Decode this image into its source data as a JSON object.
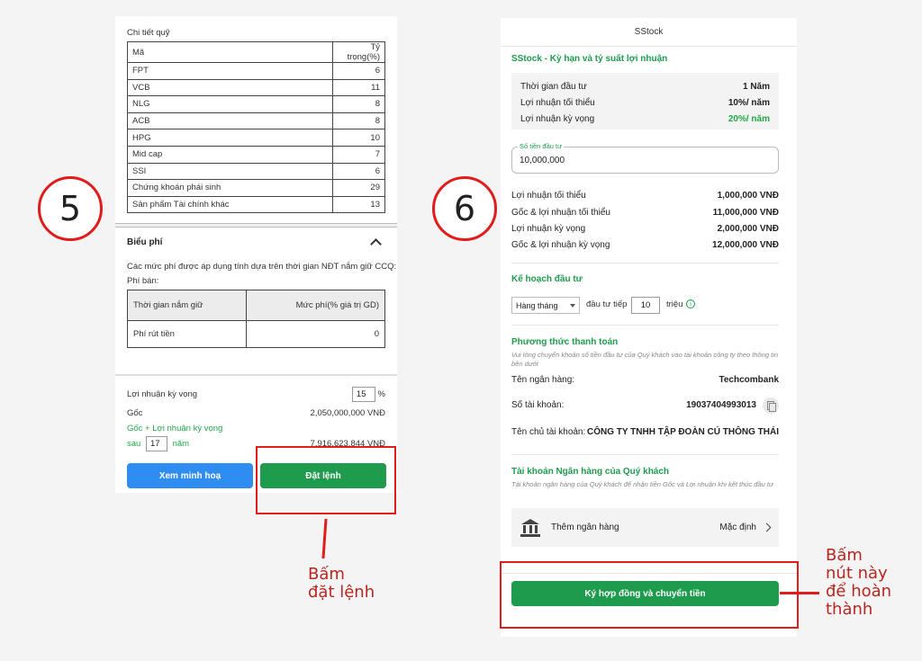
{
  "steps": {
    "left": "5",
    "right": "6"
  },
  "left_panel": {
    "fund_title": "Chi tiết quỹ",
    "fund_table": {
      "headers": [
        "Mã",
        "Tỷ trọng(%)"
      ],
      "rows": [
        [
          "FPT",
          "6"
        ],
        [
          "VCB",
          "11"
        ],
        [
          "NLG",
          "8"
        ],
        [
          "ACB",
          "8"
        ],
        [
          "HPG",
          "10"
        ],
        [
          "Mid cap",
          "7"
        ],
        [
          "SSI",
          "6"
        ],
        [
          "Chứng khoán phái sinh",
          "29"
        ],
        [
          "Sản phẩm Tài chính khác",
          "13"
        ]
      ]
    },
    "fee": {
      "title": "Biểu phí",
      "desc1": "Các mức phí được áp dụng tính dựa trên thời gian NĐT nắm giữ CCQ:",
      "desc2": "Phí bán:",
      "headers": [
        "Thời gian nắm giữ",
        "Mức phí(% giá trị GD)"
      ],
      "row": [
        "Phí rút tiền",
        "0"
      ]
    },
    "expected": {
      "label": "Lợi nhuận kỳ vọng",
      "value": "15",
      "unit": "%",
      "principal_label": "Gốc",
      "principal_value": "2,050,000,000 VNĐ",
      "total_label": "Gốc + Lợi nhuận kỳ vọng",
      "after_label": "sau",
      "years_value": "17",
      "years_unit": "năm",
      "total_value": "7,916,623,844 VNĐ"
    },
    "buttons": {
      "illustrate": "Xem minh hoạ",
      "order": "Đặt lệnh"
    },
    "annotation": [
      "Bấm",
      "đặt lệnh"
    ]
  },
  "right_panel": {
    "header": "SStock",
    "term_title": "SStock - Kỳ hạn và tỷ suất lợi nhuận",
    "summary": [
      {
        "label": "Thời gian đầu tư",
        "value": "1 Năm"
      },
      {
        "label": "Lợi nhuận tối thiểu",
        "value": "10%/ năm"
      },
      {
        "label": "Lợi nhuận kỳ vọng",
        "value": "20%/ năm"
      }
    ],
    "amount_legend": "Số tiền đầu tư",
    "amount_value": "10,000,000",
    "results": [
      {
        "label": "Lợi nhuận tối thiểu",
        "value": "1,000,000 VNĐ"
      },
      {
        "label": "Gốc & lợi nhuận tối thiểu",
        "value": "11,000,000 VNĐ"
      },
      {
        "label": "Lợi nhuận kỳ vọng",
        "value": "2,000,000 VNĐ"
      },
      {
        "label": "Gốc & lợi nhuận kỳ vọng",
        "value": "12,000,000 VNĐ"
      }
    ],
    "plan": {
      "title": "Kế hoạch đầu tư",
      "frequency": "Hàng tháng",
      "continue_label": "đầu tư tiếp",
      "continue_value": "10",
      "unit": "triệu",
      "info_glyph": "i"
    },
    "payment": {
      "title": "Phương thức thanh toán",
      "note": "Vui lòng chuyển khoản số tiền đầu tư của Quý khách vào tài khoản công ty theo thông tin bên dưới",
      "bank_label": "Tên ngân hàng:",
      "bank_value": "Techcombank",
      "account_label": "Số tài khoản:",
      "account_value": "19037404993013",
      "owner_label": "Tên chủ tài khoản:",
      "owner_value": "CÔNG TY TNHH TẬP ĐOÀN CÚ THÔNG THÁI"
    },
    "client_bank": {
      "title": "Tài khoản Ngân hàng của Quý khách",
      "note": "Tài khoản ngân hàng của Quý khách để nhận tiền Gốc và Lợi nhuận khi kết thúc đầu tư",
      "add_label": "Thêm ngân hàng",
      "default_label": "Mặc định"
    },
    "submit_button": "Ký hợp đồng và chuyển tiền",
    "annotation": [
      "Bấm",
      "nút này",
      "để hoàn",
      "thành"
    ]
  },
  "colors": {
    "accent_green": "#1e9b4d",
    "blue": "#2f8cf0",
    "annotation_red": "#e21b1b"
  }
}
